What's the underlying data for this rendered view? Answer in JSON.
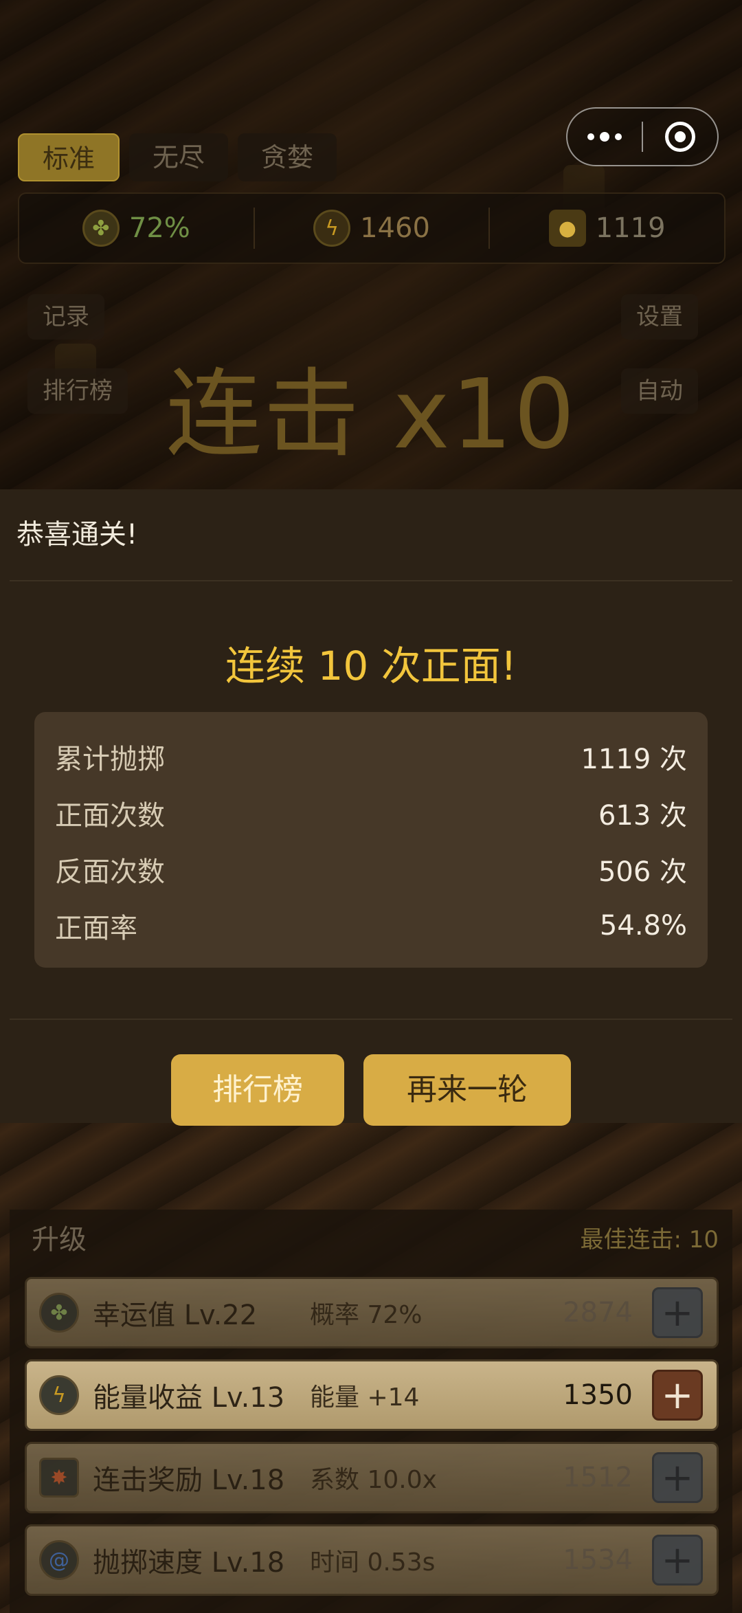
{
  "mode_tabs": [
    {
      "label": "标准",
      "active": true
    },
    {
      "label": "无尽",
      "active": false
    },
    {
      "label": "贪婪",
      "active": false
    }
  ],
  "capsule": {
    "more_icon": "more-dots-icon",
    "close_icon": "target-close-icon"
  },
  "stats": {
    "luck": {
      "icon": "clover-icon",
      "value": "72%"
    },
    "energy": {
      "icon": "lightning-icon",
      "value": "1460"
    },
    "coins": {
      "icon": "coin-stack-icon",
      "value": "1119"
    }
  },
  "side_buttons": {
    "records": "记录",
    "leaderboard": "排行榜",
    "settings": "设置",
    "auto": "自动"
  },
  "combo_title": "连击 x10",
  "modal": {
    "title": "恭喜通关!",
    "headline": "连续 10 次正面!",
    "rows": [
      {
        "label": "累计抛掷",
        "value": "1119 次"
      },
      {
        "label": "正面次数",
        "value": "613 次"
      },
      {
        "label": "反面次数",
        "value": "506 次"
      },
      {
        "label": "正面率",
        "value": "54.8%"
      }
    ],
    "leaderboard_button": "排行榜",
    "again_button": "再来一轮"
  },
  "upgrade": {
    "title": "升级",
    "best_combo": "最佳连击: 10",
    "items": [
      {
        "icon": "clover-icon",
        "name": "幸运值 Lv.22",
        "effect": "概率 72%",
        "cost": "2874",
        "affordable": false
      },
      {
        "icon": "lightning-shield-icon",
        "name": "能量收益 Lv.13",
        "effect": "能量 +14",
        "cost": "1350",
        "affordable": true
      },
      {
        "icon": "combo-burst-icon",
        "name": "连击奖励 Lv.18",
        "effect": "系数 10.0x",
        "cost": "1512",
        "affordable": false
      },
      {
        "icon": "speed-swirl-icon",
        "name": "抛掷速度 Lv.18",
        "effect": "时间 0.53s",
        "cost": "1534",
        "affordable": false
      }
    ]
  },
  "colors": {
    "accent": "#d8ac45",
    "headline": "#f2c53c",
    "modal_bg": "#2c2216"
  }
}
